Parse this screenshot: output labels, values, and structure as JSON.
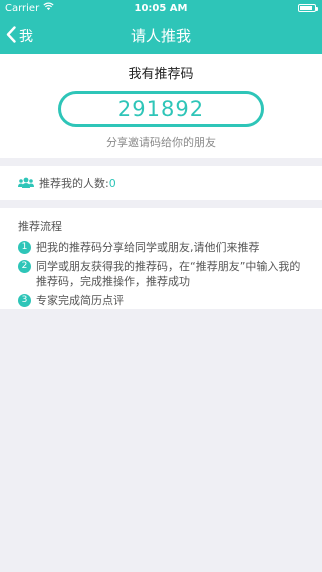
{
  "status_bar": {
    "carrier": "Carrier",
    "time": "10:05 AM",
    "battery_level": 0.85
  },
  "nav": {
    "back_label": "我",
    "title": "请人推我"
  },
  "code_card": {
    "title": "我有推荐码",
    "code": "291892",
    "hint": "分享邀请码给你的朋友"
  },
  "referral_count": {
    "label": "推荐我的人数:",
    "value": "0"
  },
  "flow": {
    "title": "推荐流程",
    "steps": [
      {
        "num": "1",
        "text": "把我的推荐码分享给同学或朋友,请他们来推荐"
      },
      {
        "num": "2",
        "text": "同学或朋友获得我的推荐码，在“推荐朋友”中输入我的推荐码，完成推操作，推荐成功"
      },
      {
        "num": "3",
        "text": "专家完成简历点评"
      }
    ]
  },
  "colors": {
    "accent": "#2ec5b8",
    "background": "#efeff4"
  },
  "icons": {
    "back": "chevron-left-icon",
    "wifi": "wifi-icon",
    "battery": "battery-icon",
    "people": "people-icon"
  }
}
